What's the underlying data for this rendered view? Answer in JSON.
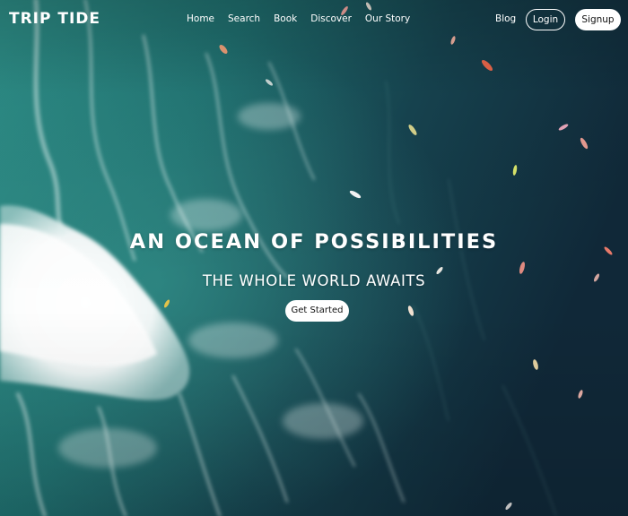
{
  "brand": {
    "name": "TRIP TIDE"
  },
  "nav": {
    "links": [
      {
        "label": "Home"
      },
      {
        "label": "Search"
      },
      {
        "label": "Book"
      },
      {
        "label": "Discover"
      },
      {
        "label": "Our Story"
      }
    ],
    "blog_label": "Blog",
    "login_label": "Login",
    "signup_label": "Signup"
  },
  "hero": {
    "headline": "AN OCEAN OF POSSIBILITIES",
    "subheadline": "THE WHOLE WORLD AWAITS",
    "cta_label": "Get Started",
    "background_image": "aerial-ocean-surfers",
    "colors": {
      "ocean_light": "#2a8a84",
      "ocean_deep": "#0f2d38",
      "foam": "#f4f8f8",
      "text": "#ffffff",
      "button_bg": "#ffffff",
      "button_text": "#111111"
    }
  }
}
